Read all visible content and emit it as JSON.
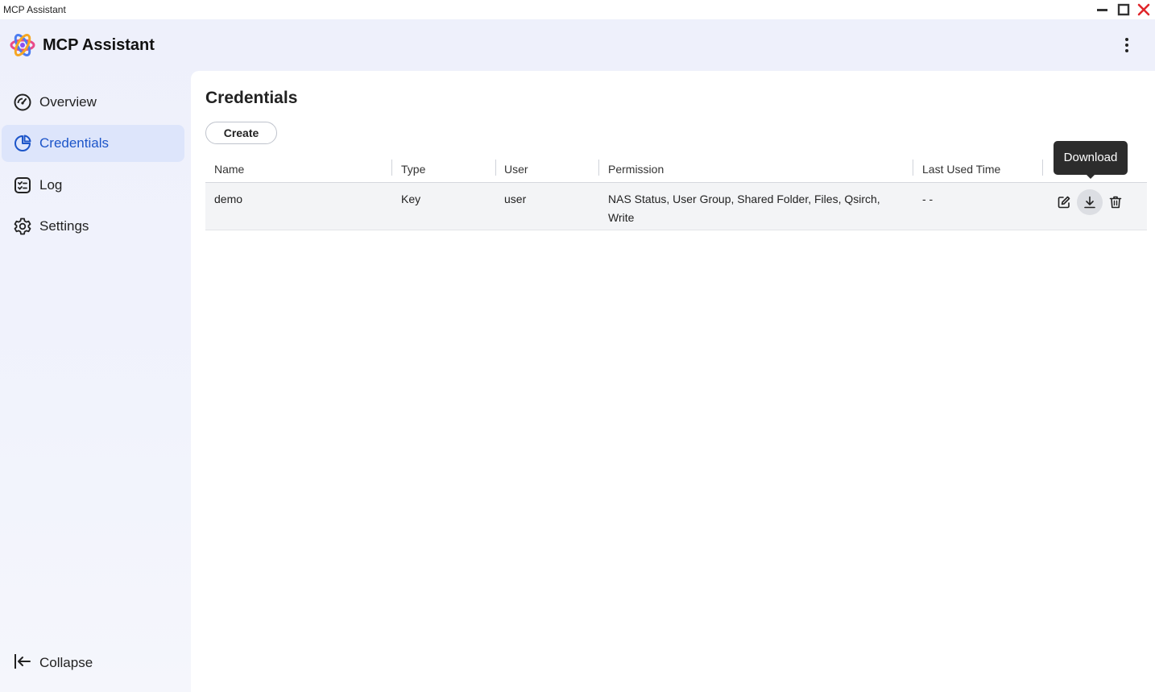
{
  "window": {
    "title": "MCP Assistant"
  },
  "app": {
    "title": "MCP Assistant"
  },
  "sidebar": {
    "items": [
      {
        "label": "Overview",
        "icon": "gauge-icon",
        "active": false
      },
      {
        "label": "Credentials",
        "icon": "credentials-pie-icon",
        "active": true
      },
      {
        "label": "Log",
        "icon": "log-icon",
        "active": false
      },
      {
        "label": "Settings",
        "icon": "gear-icon",
        "active": false
      }
    ],
    "collapse_label": "Collapse"
  },
  "main": {
    "title": "Credentials",
    "create_label": "Create",
    "table": {
      "columns": [
        "Name",
        "Type",
        "User",
        "Permission",
        "Last Used Time"
      ],
      "rows": [
        {
          "name": "demo",
          "type": "Key",
          "user": "user",
          "permission_line1": "NAS Status, User Group, Shared Folder, Files, Qsirch,",
          "permission_line2": "Write",
          "last_used": "- -"
        }
      ]
    },
    "tooltip": "Download"
  },
  "colors": {
    "accent": "#1c55c9",
    "active_bg": "#dde5fb",
    "close": "#e0262b"
  }
}
